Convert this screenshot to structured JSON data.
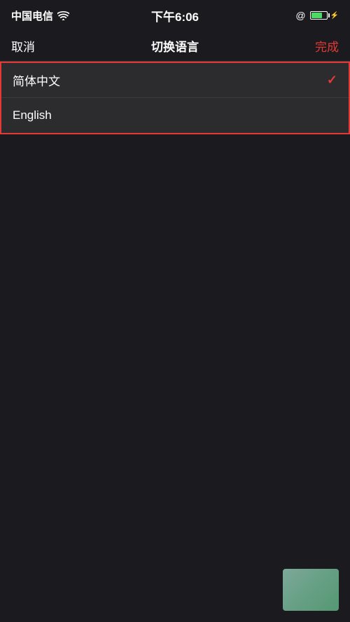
{
  "statusBar": {
    "carrier": "中国电信",
    "time": "下午6:06",
    "rightLabel": "@"
  },
  "navBar": {
    "cancelLabel": "取消",
    "titleLabel": "切换语言",
    "doneLabel": "完成"
  },
  "languages": [
    {
      "id": "simplified-chinese",
      "label": "简体中文",
      "selected": true
    },
    {
      "id": "english",
      "label": "English",
      "selected": false
    }
  ],
  "colors": {
    "accent": "#e53935",
    "background": "#1a1a1f",
    "listBackground": "#2c2c2e",
    "separator": "#3a3a3f",
    "text": "#ffffff"
  }
}
